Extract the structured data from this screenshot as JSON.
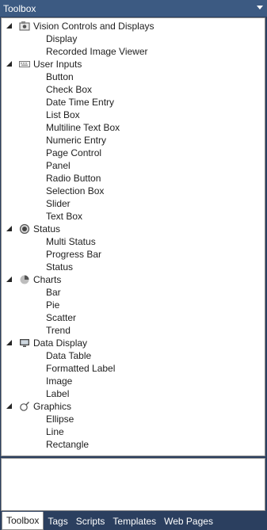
{
  "window": {
    "title": "Toolbox"
  },
  "categories": [
    {
      "label": "Vision Controls and Displays",
      "icon": "vision-icon",
      "items": [
        "Display",
        "Recorded Image Viewer"
      ]
    },
    {
      "label": "User Inputs",
      "icon": "keyboard-icon",
      "items": [
        "Button",
        "Check Box",
        "Date Time Entry",
        "List Box",
        "Multiline Text Box",
        "Numeric Entry",
        "Page Control",
        "Panel",
        "Radio Button",
        "Selection Box",
        "Slider",
        "Text Box"
      ]
    },
    {
      "label": "Status",
      "icon": "status-icon",
      "items": [
        "Multi Status",
        "Progress Bar",
        "Status"
      ]
    },
    {
      "label": "Charts",
      "icon": "pie-chart-icon",
      "items": [
        "Bar",
        "Pie",
        "Scatter",
        "Trend"
      ]
    },
    {
      "label": "Data Display",
      "icon": "monitor-icon",
      "items": [
        "Data Table",
        "Formatted Label",
        "Image",
        "Label"
      ]
    },
    {
      "label": "Graphics",
      "icon": "graphics-icon",
      "items": [
        "Ellipse",
        "Line",
        "Rectangle"
      ]
    }
  ],
  "tabs": [
    {
      "label": "Toolbox",
      "active": true
    },
    {
      "label": "Tags",
      "active": false
    },
    {
      "label": "Scripts",
      "active": false
    },
    {
      "label": "Templates",
      "active": false
    },
    {
      "label": "Web Pages",
      "active": false
    }
  ],
  "colors": {
    "titlebar": "#3c5a82",
    "frame": "#2b3f5f",
    "panel": "#ffffff"
  }
}
